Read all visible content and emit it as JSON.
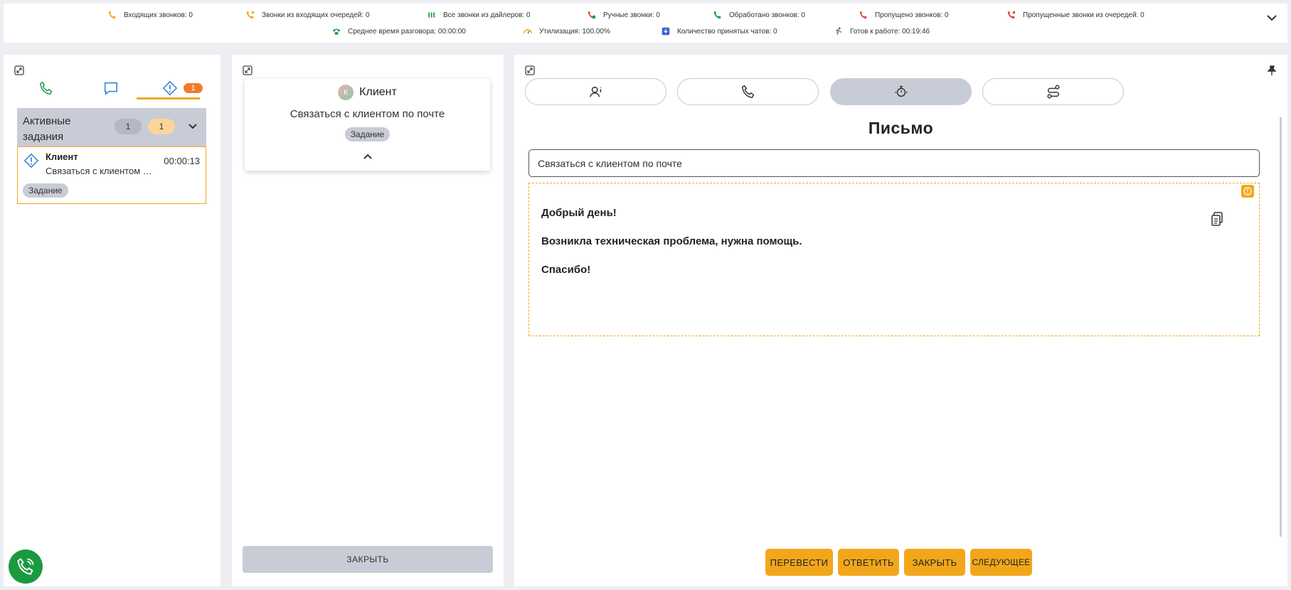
{
  "stats_row1": [
    {
      "label": "Входящих звонков: 0",
      "icon": "incoming-call-icon"
    },
    {
      "label": "Звонки из входящих очередей: 0",
      "icon": "queue-calls-icon"
    },
    {
      "label": "Все звонки из дайлеров: 0",
      "icon": "dialer-calls-icon"
    },
    {
      "label": "Ручные звонки: 0",
      "icon": "manual-call-icon"
    },
    {
      "label": "Обработано звонков: 0",
      "icon": "processed-calls-icon"
    },
    {
      "label": "Пропущено звонков: 0",
      "icon": "missed-calls-icon"
    },
    {
      "label": "Пропущенные звонки из очередей: 0",
      "icon": "missed-queue-calls-icon"
    }
  ],
  "stats_row2": [
    {
      "label": "Среднее время разговора: 00:00:00",
      "icon": "avg-talk-time-icon"
    },
    {
      "label": "Утилизация: 100.00%",
      "icon": "utilization-gauge-icon"
    },
    {
      "label": "Количество принятых чатов: 0",
      "icon": "accepted-chats-icon"
    },
    {
      "label": "Готов к работе: 00:19:46",
      "icon": "ready-status-icon"
    }
  ],
  "left_panel": {
    "tasks_badge": "1",
    "group": {
      "title": "Активные задания",
      "count_grey": "1",
      "count_orange": "1"
    },
    "task": {
      "name": "Клиент",
      "description": "Связаться с клиентом по почте",
      "time": "00:00:13",
      "tag": "Задание"
    }
  },
  "middle_panel": {
    "card": {
      "avatar_letter": "К",
      "name": "Клиент",
      "description": "Связаться с клиентом по почте",
      "tag": "Задание"
    },
    "close_label": "ЗАКРЫТЬ"
  },
  "right_panel": {
    "title": "Письмо",
    "subject": "Связаться с клиентом по почте",
    "body_lines": [
      "Добрый день!",
      "Возникла техническая проблема, нужна помощь.",
      "Спасибо!"
    ],
    "buttons": {
      "transfer": "ПЕРЕВЕСТИ",
      "reply": "ОТВЕТИТЬ",
      "close": "ЗАКРЫТЬ",
      "next": "СЛЕДУЮЩЕЕ"
    }
  },
  "colors": {
    "accent": "#f2a71b",
    "badge": "#ef7c2e",
    "green": "#1a9a3e",
    "tab_blue": "#2e7cd6",
    "grey": "#c8ccd6"
  }
}
